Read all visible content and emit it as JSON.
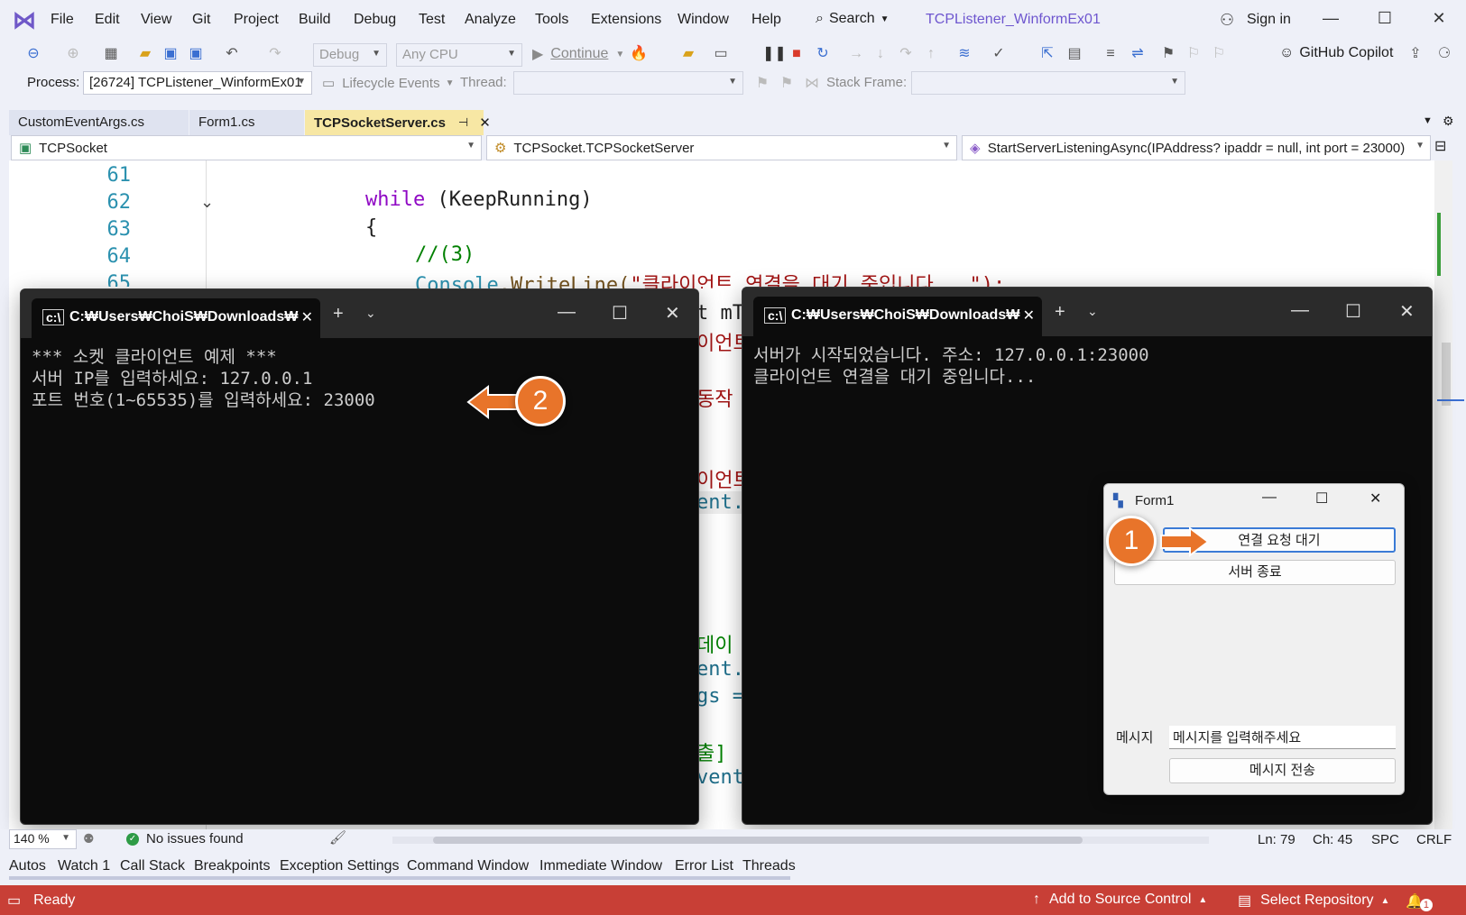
{
  "menu": [
    "File",
    "Edit",
    "View",
    "Git",
    "Project",
    "Build",
    "Debug",
    "Test",
    "Analyze",
    "Tools",
    "Extensions",
    "Window",
    "Help"
  ],
  "search_label": "Search",
  "project_name": "TCPListener_WinformEx01",
  "sign_in": "Sign in",
  "toolbar": {
    "config": "Debug",
    "platform": "Any CPU",
    "continue": "Continue",
    "copilot": "GitHub Copilot"
  },
  "debugbar": {
    "process_label": "Process:",
    "process_value": "[26724] TCPListener_WinformEx01",
    "lifecycle": "Lifecycle Events",
    "thread_label": "Thread:",
    "stackframe_label": "Stack Frame:"
  },
  "tabs": [
    "CustomEventArgs.cs",
    "Form1.cs",
    "TCPSocketServer.cs"
  ],
  "nav": {
    "project": "TCPSocket",
    "type": "TCPSocket.TCPSocketServer",
    "member": "StartServerListeningAsync(IPAddress? ipaddr = null, int port = 23000)"
  },
  "code": {
    "lines": [
      "61",
      "62",
      "63",
      "64",
      "65"
    ],
    "while_kw": "while",
    "while_rest": " (KeepRunning)",
    "brace": "{",
    "comment": "//(3)",
    "console_cls": "Console",
    "writeline": ".WriteLine(",
    "str": "\"클라이언트 연결을 대기 중입니다...\");",
    "peek": [
      "t mT",
      "이언트",
      "동작",
      "이언트",
      "ent.",
      "데이",
      "ent.",
      "gs =",
      "출]",
      "vent"
    ]
  },
  "client_console": {
    "tab_title": "C:₩Users₩ChoiS₩Downloads₩",
    "lines": [
      "*** 소켓 클라이언트 예제 ***",
      "서버 IP를 입력하세요: 127.0.0.1",
      "포트 번호(1~65535)를 입력하세요: 23000"
    ]
  },
  "server_console": {
    "tab_title": "C:₩Users₩ChoiS₩Downloads₩",
    "lines": [
      "서버가 시작되었습니다. 주소: 127.0.0.1:23000",
      "클라이언트 연결을 대기 중입니다..."
    ]
  },
  "form1": {
    "title": "Form1",
    "btn_wait": "연결 요청 대기",
    "btn_stop": "서버 종료",
    "msg_label": "메시지",
    "msg_placeholder": "메시지를 입력해주세요",
    "btn_send": "메시지 전송"
  },
  "badges": {
    "one": "1",
    "two": "2"
  },
  "editor_status": {
    "zoom": "140 %",
    "issues": "No issues found",
    "ln": "Ln: 79",
    "ch": "Ch: 45",
    "spc": "SPC",
    "crlf": "CRLF"
  },
  "toolwindows": [
    "Autos",
    "Watch 1",
    "Call Stack",
    "Breakpoints",
    "Exception Settings",
    "Command Window",
    "Immediate Window",
    "Error List",
    "Threads"
  ],
  "status": {
    "ready": "Ready",
    "source_control": "Add to Source Control",
    "repo": "Select Repository",
    "notif_count": "1"
  },
  "colors": {
    "accent": "#6e56cf",
    "statusbar": "#c83f36",
    "badge": "#e8742a",
    "active_tab": "#f7e7a4"
  }
}
